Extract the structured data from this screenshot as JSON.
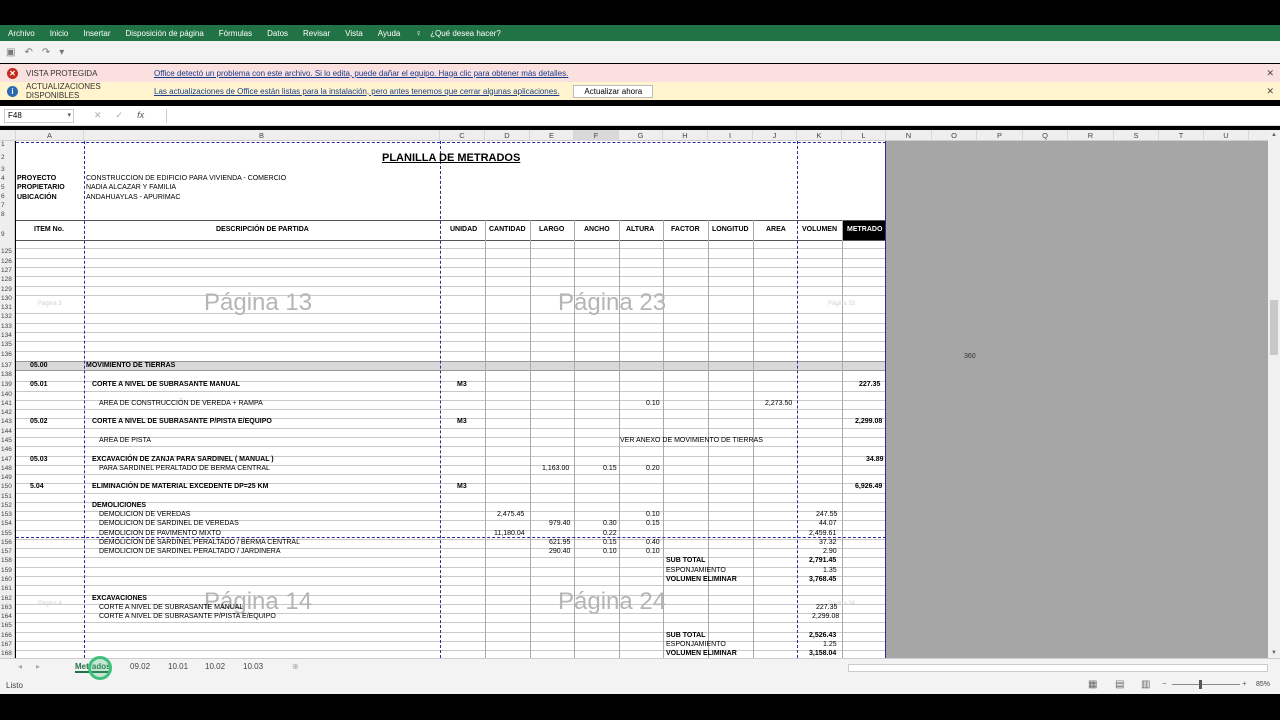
{
  "menu": [
    "Archivo",
    "Inicio",
    "Insertar",
    "Disposición de página",
    "Fórmulas",
    "Datos",
    "Revisar",
    "Vista",
    "Ayuda",
    "¿Qué desea hacer?"
  ],
  "protected": {
    "title": "VISTA PROTEGIDA",
    "message": "Office detectó un problema con este archivo. Si lo edita, puede dañar el equipo. Haga clic para obtener más detalles."
  },
  "updates": {
    "title": "ACTUALIZACIONES DISPONIBLES",
    "message": "Las actualizaciones de Office están listas para la instalación, pero antes tenemos que cerrar algunas aplicaciones.",
    "button": "Actualizar ahora"
  },
  "namebox": "F48",
  "columns": [
    "A",
    "B",
    "C",
    "D",
    "E",
    "F",
    "G",
    "H",
    "I",
    "J",
    "K",
    "L",
    "N",
    "O",
    "P",
    "Q",
    "R",
    "S",
    "T",
    "U"
  ],
  "sheet": {
    "title": "PLANILLA DE METRADOS",
    "proyecto_label": "PROYECTO",
    "proyecto": "CONSTRUCCION DE EDIFICIO PARA VIVIENDA - COMERCIO",
    "propietario_label": "PROPIETARIO",
    "propietario": "NADIA ALCAZAR Y FAMILIA",
    "ubicacion_label": "UBICACIÓN",
    "ubicacion": "ANDAHUAYLAS - APURIMAC",
    "headers": [
      "ITEM No.",
      "DESCRIPCIÓN DE PARTIDA",
      "UNIDAD",
      "CANTIDAD",
      "LARGO",
      "ANCHO",
      "ALTURA",
      "FACTOR",
      "LONGITUD",
      "AREA",
      "VOLUMEN",
      "METRADO"
    ],
    "watermarks": [
      "Página 13",
      "Página 23",
      "Página 14",
      "Página 24",
      "Página 3",
      "Página 33",
      "Página 4",
      "Página 34"
    ],
    "gray_value": "360",
    "r137a": "05.00",
    "r137b": "MOVIMIENTO DE TIERRAS",
    "r139a": "05.01",
    "r139b": "CORTE A NIVEL DE SUBRASANTE MANUAL",
    "r139c": "M3",
    "r139l": "227.35",
    "r141b": "AREA DE CONSTRUCCIÓN DE VEREDA + RAMPA",
    "r141g": "0.10",
    "r141j": "2,273.50",
    "r143a": "05.02",
    "r143b": "CORTE A NIVEL DE SUBRASANTE P/PISTA E/EQUIPO",
    "r143c": "M3",
    "r143l": "2,299.08",
    "r145b": "AREA DE PISTA",
    "r145f": "VER ANEXO DE MOVIMIENTO DE TIERRAS",
    "r147a": "05.03",
    "r147b": "EXCAVACIÓN DE ZANJA PARA SARDINEL ( MANUAL )",
    "r147l": "34.89",
    "r148b": "PARA SARDINEL PERALTADO DE BERMA CENTRAL",
    "r148e": "1,163.00",
    "r148f": "0.15",
    "r148g": "0.20",
    "r150a": "5.04",
    "r150b": "ELIMINACIÓN DE MATERIAL EXCEDENTE DP=25 KM",
    "r150c": "M3",
    "r150l": "6,926.49",
    "r152b": "DEMOLICIONES",
    "r153b": "DEMOLICION DE VEREDAS",
    "r153d": "2,475.45",
    "r153g": "0.10",
    "r153k": "247.55",
    "r154b": "DEMOLICION DE SARDINEL DE VEREDAS",
    "r154e": "979.40",
    "r154f": "0.30",
    "r154g": "0.15",
    "r154k": "44.07",
    "r155b": "DEMOLICION DE PAVIMENTO MIXTO",
    "r155d": "11,180.04",
    "r155g": "0.22",
    "r155k": "2,459.61",
    "r156b": "DEMOLICION DE SARDINEL PERALTADO / BERMA CENTRAL",
    "r156e": "621.95",
    "r156f": "0.15",
    "r156g": "0.40",
    "r156k": "37.32",
    "r157b": "DEMOLICION DE SARDINEL PERALTADO / JARDINERA",
    "r157e": "290.40",
    "r157f": "0.10",
    "r157g": "0.10",
    "r157k": "2.90",
    "r158h": "SUB TOTAL",
    "r158k": "2,791.45",
    "r159h": "ESPONJAMIENTO",
    "r159k": "1.35",
    "r160h": "VOLUMEN ELIMINAR",
    "r160k": "3,768.45",
    "r162b": "EXCAVACIONES",
    "r163b": "CORTE A NIVEL DE SUBRASANTE MANUAL",
    "r163k": "227.35",
    "r164b": "CORTE A NIVEL DE SUBRASANTE P/PISTA E/EQUIPO",
    "r164k": "2,299.08",
    "r166h": "SUB TOTAL",
    "r166k": "2,526.43",
    "r167h": "ESPONJAMIENTO",
    "r167k": "1.25",
    "r168h": "VOLUMEN ELIMINAR",
    "r168k": "3,158.04"
  },
  "rows": [
    "1",
    "2",
    "3",
    "4",
    "5",
    "6",
    "7",
    "8",
    "9",
    "125",
    "126",
    "127",
    "128",
    "129",
    "130",
    "131",
    "132",
    "133",
    "134",
    "135",
    "136",
    "137",
    "138",
    "139",
    "140",
    "141",
    "142",
    "143",
    "144",
    "145",
    "146",
    "147",
    "148",
    "149",
    "150",
    "151",
    "152",
    "153",
    "154",
    "155",
    "156",
    "157",
    "158",
    "159",
    "160",
    "161",
    "162",
    "163",
    "164",
    "165",
    "166",
    "167",
    "168"
  ],
  "tabs": [
    "Metrados",
    "09.02",
    "10.01",
    "10.02",
    "10.03"
  ],
  "status": "Listo",
  "zoom": "85%"
}
